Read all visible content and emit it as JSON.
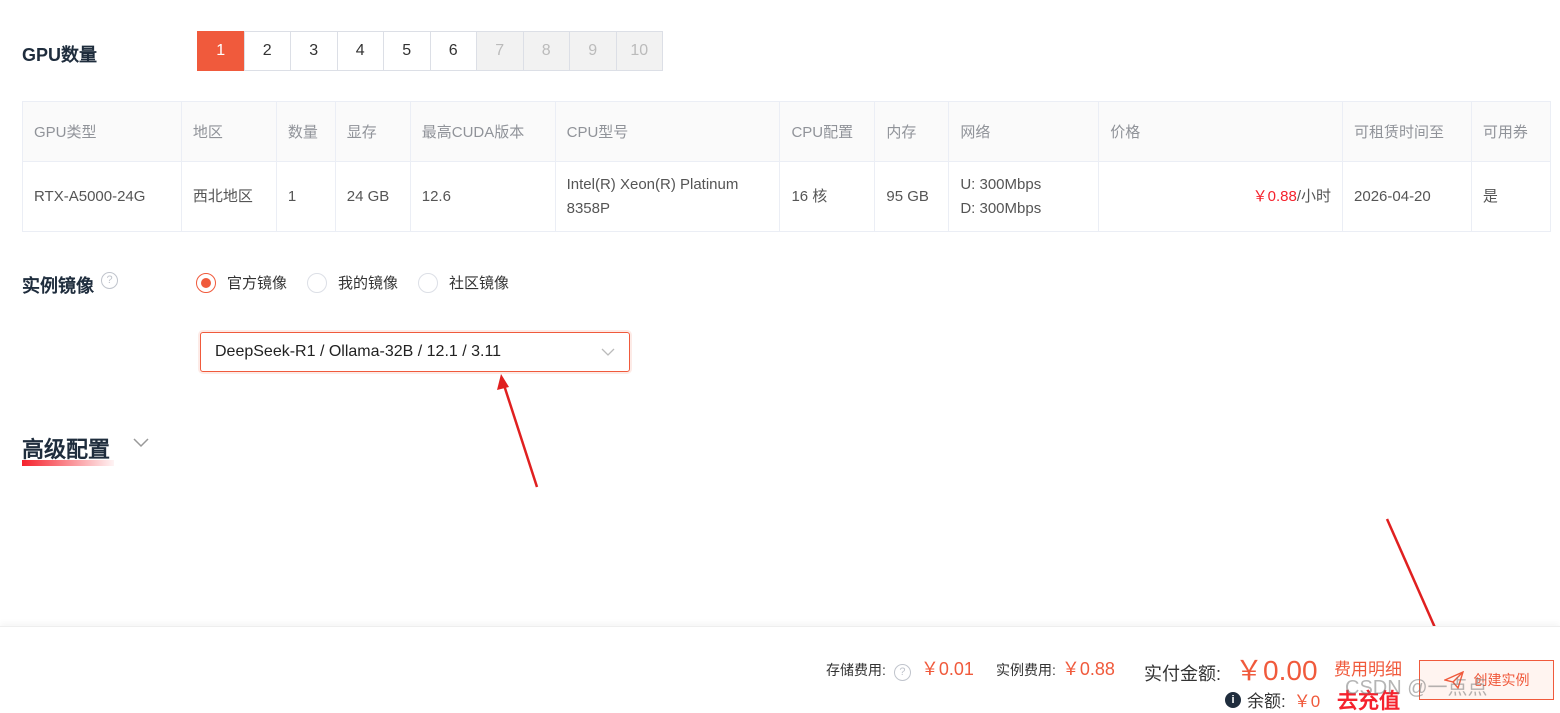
{
  "gpu_count": {
    "label": "GPU数量",
    "options": [
      "1",
      "2",
      "3",
      "4",
      "5",
      "6",
      "7",
      "8",
      "9",
      "10"
    ]
  },
  "table": {
    "headers": [
      "GPU类型",
      "地区",
      "数量",
      "显存",
      "最高CUDA版本",
      "CPU型号",
      "CPU配置",
      "内存",
      "网络",
      "价格",
      "可租赁时间至",
      "可用券"
    ],
    "row": {
      "gpu_type": "RTX-A5000-24G",
      "region": "西北地区",
      "count": "1",
      "vram": "24 GB",
      "cuda": "12.6",
      "cpu_model_line1": "Intel(R) Xeon(R) Platinum",
      "cpu_model_line2": "8358P",
      "cpu_config": "16 核",
      "memory": "95 GB",
      "network_up": "U: 300Mbps",
      "network_down": "D: 300Mbps",
      "price": "￥0.88",
      "price_unit": "/小时",
      "rent_until": "2026-04-20",
      "coupon": "是"
    }
  },
  "image": {
    "label": "实例镜像",
    "help": "?",
    "options": [
      "官方镜像",
      "我的镜像",
      "社区镜像"
    ],
    "selected": "DeepSeek-R1 / Ollama-32B / 12.1 / 3.11"
  },
  "advanced": {
    "label": "高级配置"
  },
  "footer": {
    "storage_label": "存储费用:",
    "storage_value": "￥0.01",
    "instance_label": "实例费用:",
    "instance_value": "￥0.88",
    "total_label": "实付金额:",
    "total_value": "￥0.00",
    "detail_link": "费用明细",
    "balance_label": "余额:",
    "balance_value": "￥0",
    "recharge": "去充值",
    "create_button": "创建实例",
    "watermark": "CSDN @一点点"
  },
  "colors": {
    "accent": "#f05a3c",
    "annotation": "#e02020"
  }
}
